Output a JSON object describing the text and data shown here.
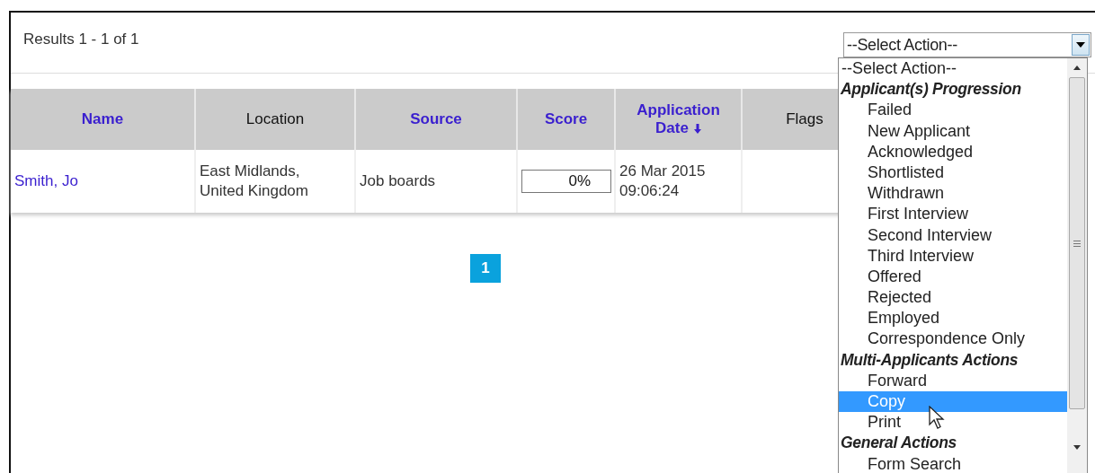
{
  "results": {
    "text": "Results 1 - 1 of 1"
  },
  "action_select": {
    "value": "--Select Action--"
  },
  "table": {
    "columns": [
      {
        "label": "Name",
        "kind": "link",
        "sorted": false
      },
      {
        "label": "Location",
        "kind": "plain",
        "sorted": false
      },
      {
        "label": "Source",
        "kind": "link",
        "sorted": false
      },
      {
        "label": "Score",
        "kind": "link",
        "sorted": false
      },
      {
        "label": "Application Date",
        "kind": "link",
        "sorted": true
      },
      {
        "label": "Flags",
        "kind": "plain",
        "sorted": false
      }
    ],
    "rows": [
      {
        "name": "Smith, Jo",
        "location": "East Midlands,\nUnited Kingdom",
        "source": "Job boards",
        "score": "0%",
        "date": "26 Mar 2015\n09:06:24"
      }
    ]
  },
  "pagination": [
    {
      "label": "1",
      "selected": true
    }
  ],
  "dropdown": {
    "options": [
      {
        "label": "--Select Action--",
        "kind": "option",
        "selected": false
      },
      {
        "label": "Applicant(s) Progression",
        "kind": "group",
        "selected": false
      },
      {
        "label": "Failed",
        "kind": "option",
        "selected": false
      },
      {
        "label": "New Applicant",
        "kind": "option",
        "selected": false
      },
      {
        "label": "Acknowledged",
        "kind": "option",
        "selected": false
      },
      {
        "label": "Shortlisted",
        "kind": "option",
        "selected": false
      },
      {
        "label": "Withdrawn",
        "kind": "option",
        "selected": false
      },
      {
        "label": "First Interview",
        "kind": "option",
        "selected": false
      },
      {
        "label": "Second Interview",
        "kind": "option",
        "selected": false
      },
      {
        "label": "Third Interview",
        "kind": "option",
        "selected": false
      },
      {
        "label": "Offered",
        "kind": "option",
        "selected": false
      },
      {
        "label": "Rejected",
        "kind": "option",
        "selected": false
      },
      {
        "label": "Employed",
        "kind": "option",
        "selected": false
      },
      {
        "label": "Correspondence Only",
        "kind": "option",
        "selected": false
      },
      {
        "label": "Multi-Applicants Actions",
        "kind": "group",
        "selected": false
      },
      {
        "label": "Forward",
        "kind": "option",
        "selected": false
      },
      {
        "label": "Copy",
        "kind": "option",
        "selected": true
      },
      {
        "label": "Print",
        "kind": "option",
        "selected": false
      },
      {
        "label": "General Actions",
        "kind": "group",
        "selected": false
      },
      {
        "label": "Form Search",
        "kind": "option",
        "selected": false
      }
    ]
  }
}
